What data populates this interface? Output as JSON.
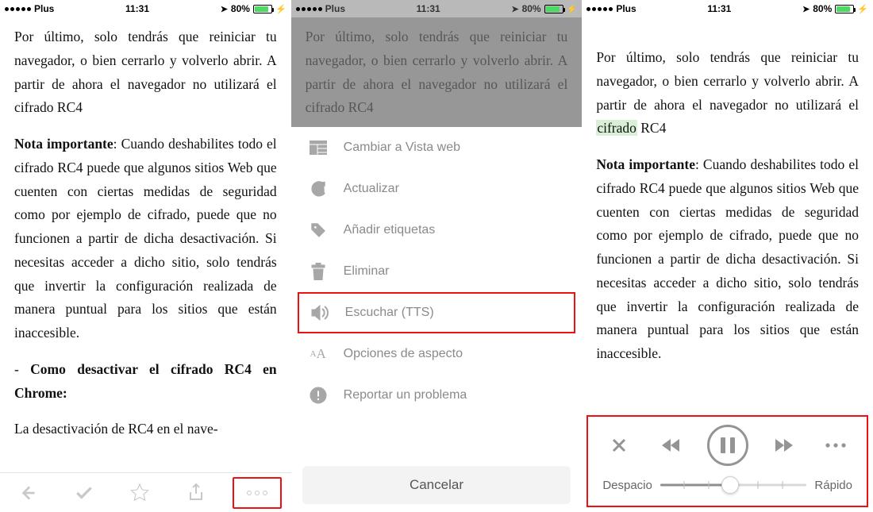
{
  "statusbar": {
    "carrier": "Plus",
    "time": "11:31",
    "battery": "80%"
  },
  "article": {
    "para1": "Por último, solo tendrás que reini­ciar tu navegador, o bien cerrarlo y volverlo abrir. A partir de ahora el navegador no utilizará el cifrado RC4",
    "para1_pre": "Por último, solo tendrás que reini­ciar tu navegador, o bien cerrarlo y volverlo abrir. A partir de ahora el navegador no utilizará el ",
    "para1_mark": "cifrado",
    "para1_post": " RC4",
    "nota_label": "Nota importante",
    "nota_body": ": Cuando deshabili­tes todo el cifrado RC4 puede que al­gunos sitios Web que cuenten con ciertas medidas de seguridad como por ejemplo de cifrado, puede que no funcionen a partir de dicha desac­tivación. Si necesitas acceder a dicho sitio, solo tendrás que invertir la con­figuración realizada de manera pun­tual para los sitios que están inaccesi­ble.",
    "h2_bullet": "- ",
    "h2": "Como desactivar el cifrado RC4 en Chrome:",
    "para3": "La desactivación de RC4 en el nave-"
  },
  "menu": {
    "items": {
      "webview": "Cambiar a Vista web",
      "refresh": "Actualizar",
      "tags": "Añadir etiquetas",
      "delete": "Eliminar",
      "tts": "Escuchar (TTS)",
      "appearance": "Opciones de aspecto",
      "report": "Reportar un problema"
    },
    "cancel": "Cancelar"
  },
  "player": {
    "slow": "Despacio",
    "fast": "Rápido"
  }
}
